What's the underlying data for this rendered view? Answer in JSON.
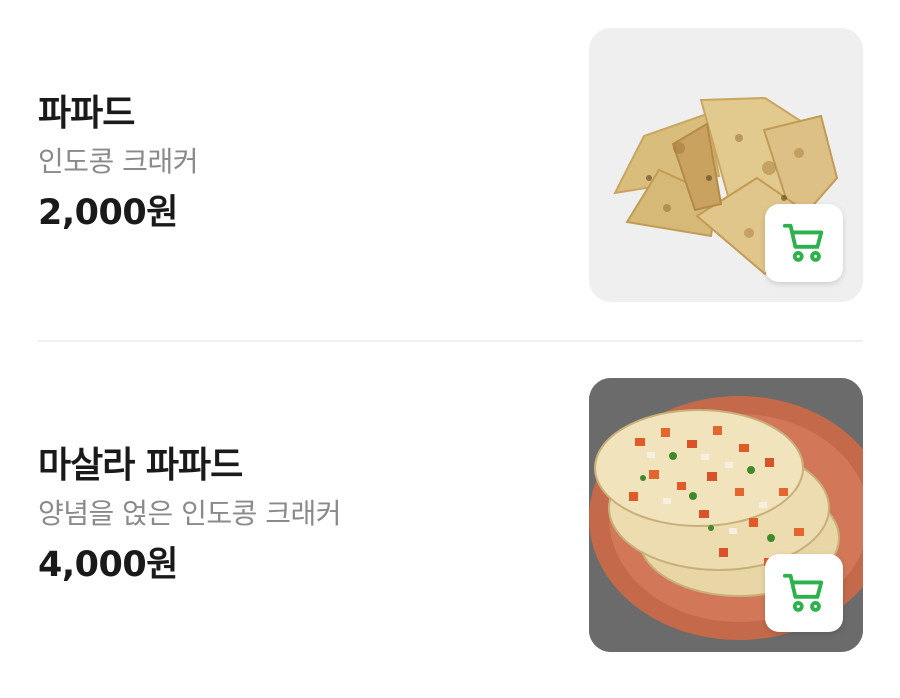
{
  "items": [
    {
      "name": "파파드",
      "description": "인도콩 크래커",
      "price": "2,000원",
      "image_icon": "papad-image",
      "cart_icon": "cart-icon"
    },
    {
      "name": "마살라 파파드",
      "description": "양념을 얹은 인도콩 크래커",
      "price": "4,000원",
      "image_icon": "masala-papad-image",
      "cart_icon": "cart-icon"
    }
  ],
  "colors": {
    "accent": "#2bb24c",
    "name_text": "#1a1a1a",
    "desc_text": "#8a8a8a",
    "divider": "#f0f0f0"
  }
}
